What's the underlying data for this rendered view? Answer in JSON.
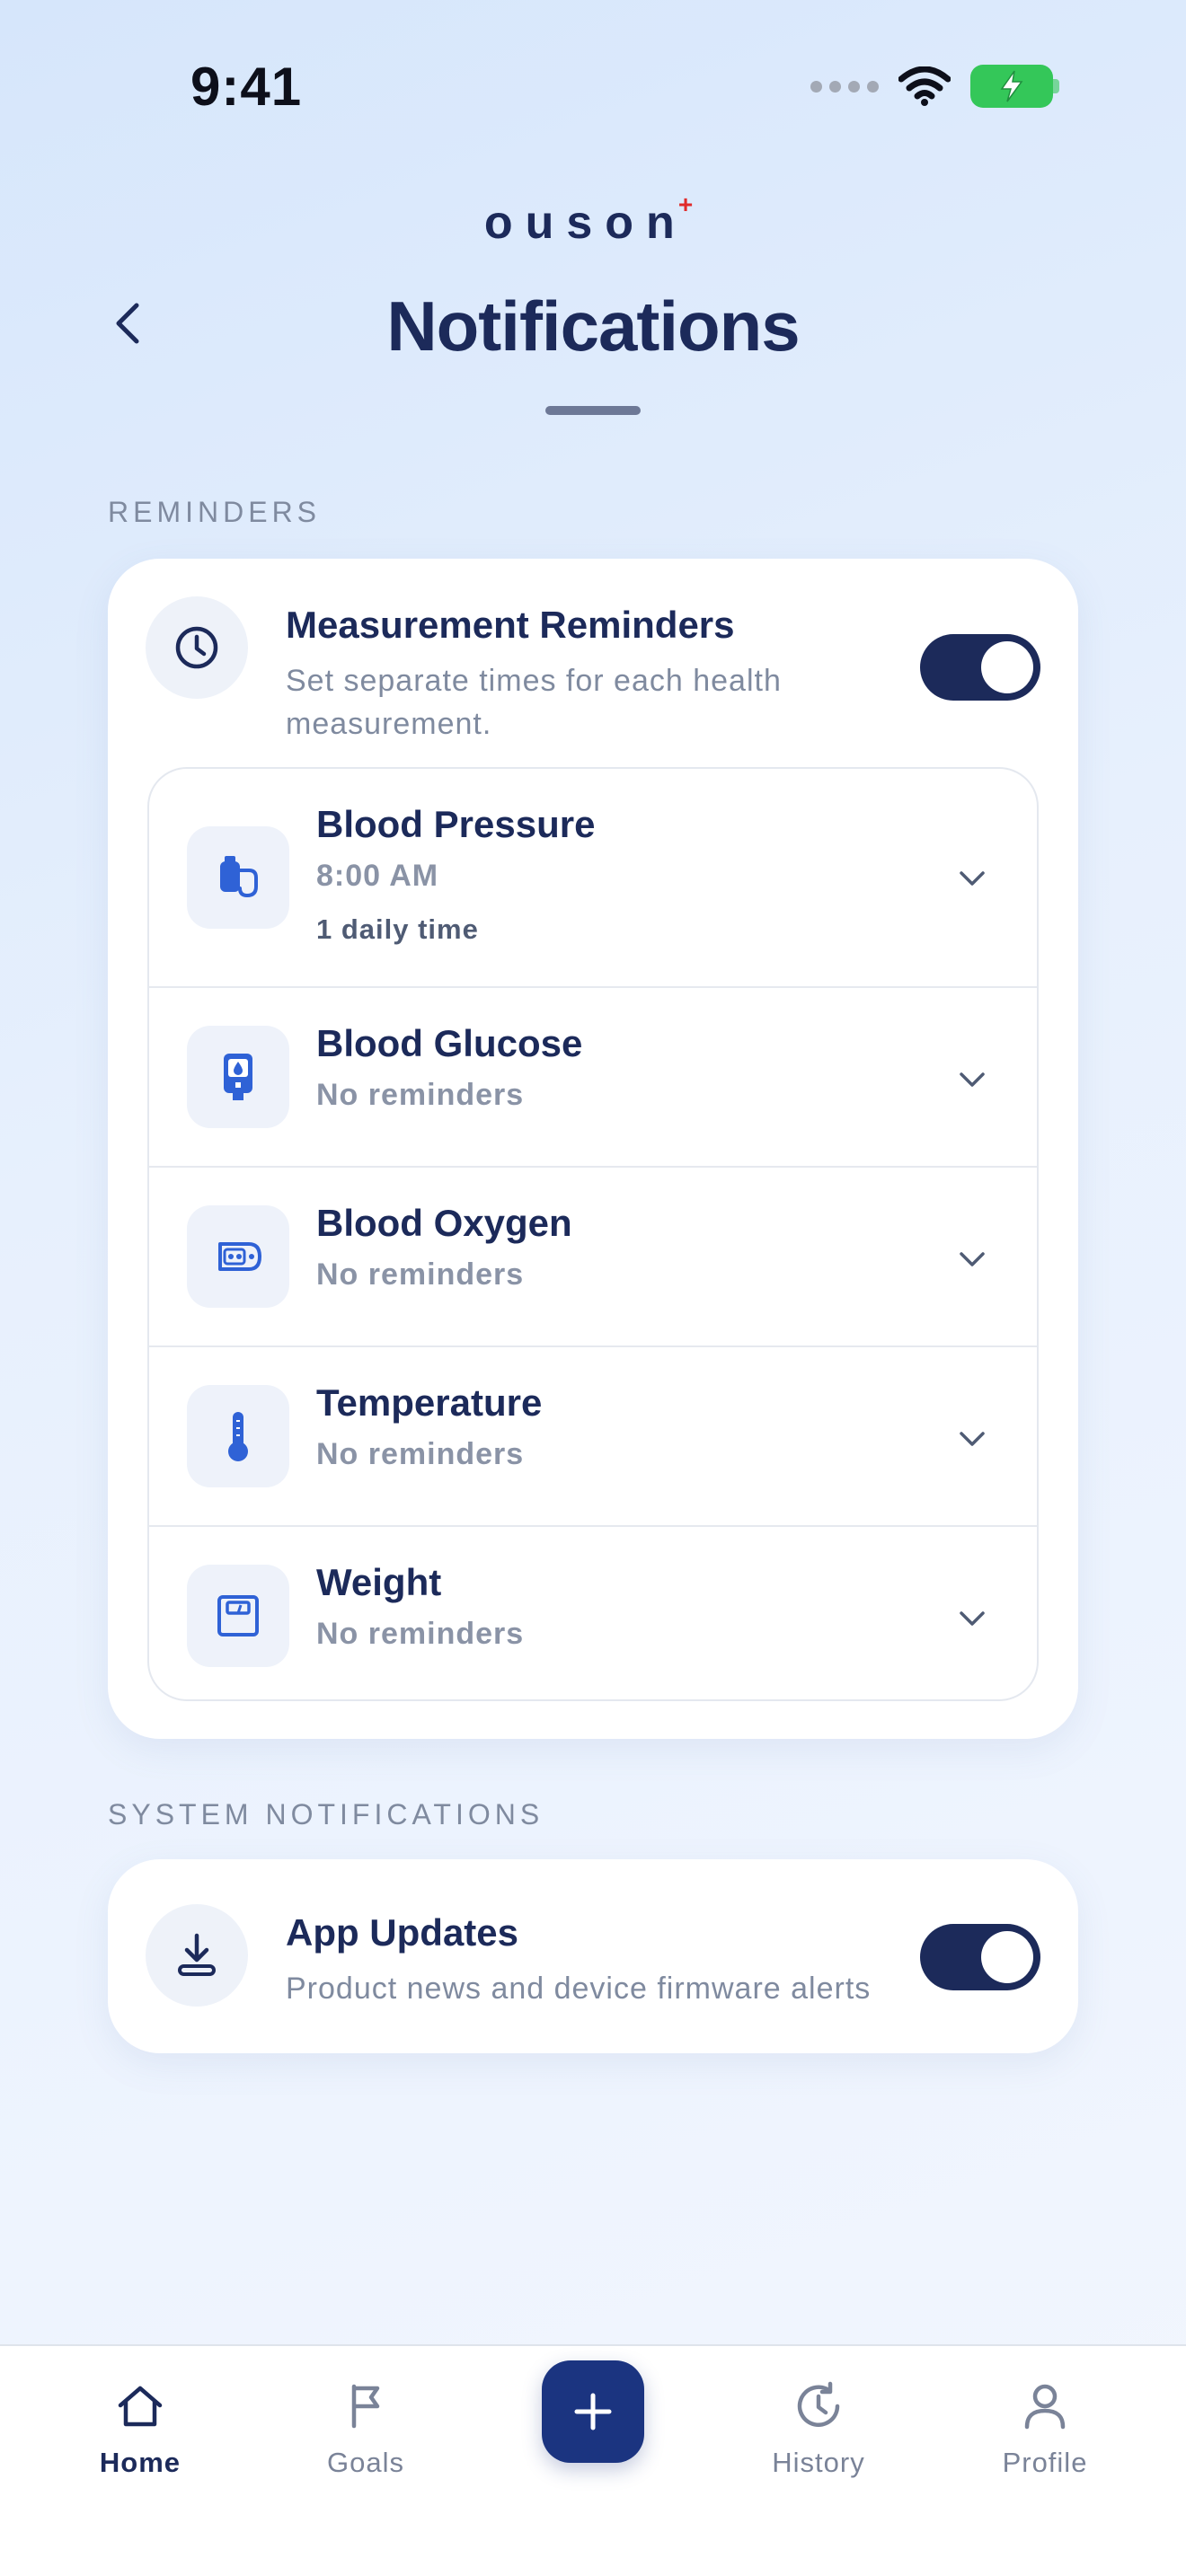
{
  "status_bar": {
    "time": "9:41"
  },
  "brand": {
    "logo_text": "ouson",
    "logo_mark": "+"
  },
  "header": {
    "title": "Notifications"
  },
  "reminders_section": {
    "label": "REMINDERS",
    "master": {
      "title": "Measurement Reminders",
      "subtitle_line1": "Set separate times for each health",
      "subtitle_line2": "measurement.",
      "enabled": true
    },
    "items": [
      {
        "title": "Blood Pressure",
        "subtitle": "8:00 AM",
        "count": "1 daily time",
        "icon": "blood-pressure-icon"
      },
      {
        "title": "Blood Glucose",
        "subtitle": "No reminders",
        "icon": "glucose-meter-icon"
      },
      {
        "title": "Blood Oxygen",
        "subtitle": "No reminders",
        "icon": "oximeter-icon"
      },
      {
        "title": "Temperature",
        "subtitle": "No reminders",
        "icon": "thermometer-icon"
      },
      {
        "title": "Weight",
        "subtitle": "No reminders",
        "icon": "scale-icon"
      }
    ]
  },
  "system_section": {
    "label": "SYSTEM NOTIFICATIONS",
    "app_updates": {
      "title": "App Updates",
      "subtitle": "Product news and device firmware alerts",
      "enabled": true
    }
  },
  "tab_bar": {
    "home": "Home",
    "goals": "Goals",
    "history": "History",
    "profile": "Profile",
    "active": "Home"
  },
  "colors": {
    "primary": "#1c2a5a",
    "accent": "#2f62d6",
    "fab": "#1b3480",
    "battery": "#34c759",
    "logo_mark": "#e02b2b"
  }
}
